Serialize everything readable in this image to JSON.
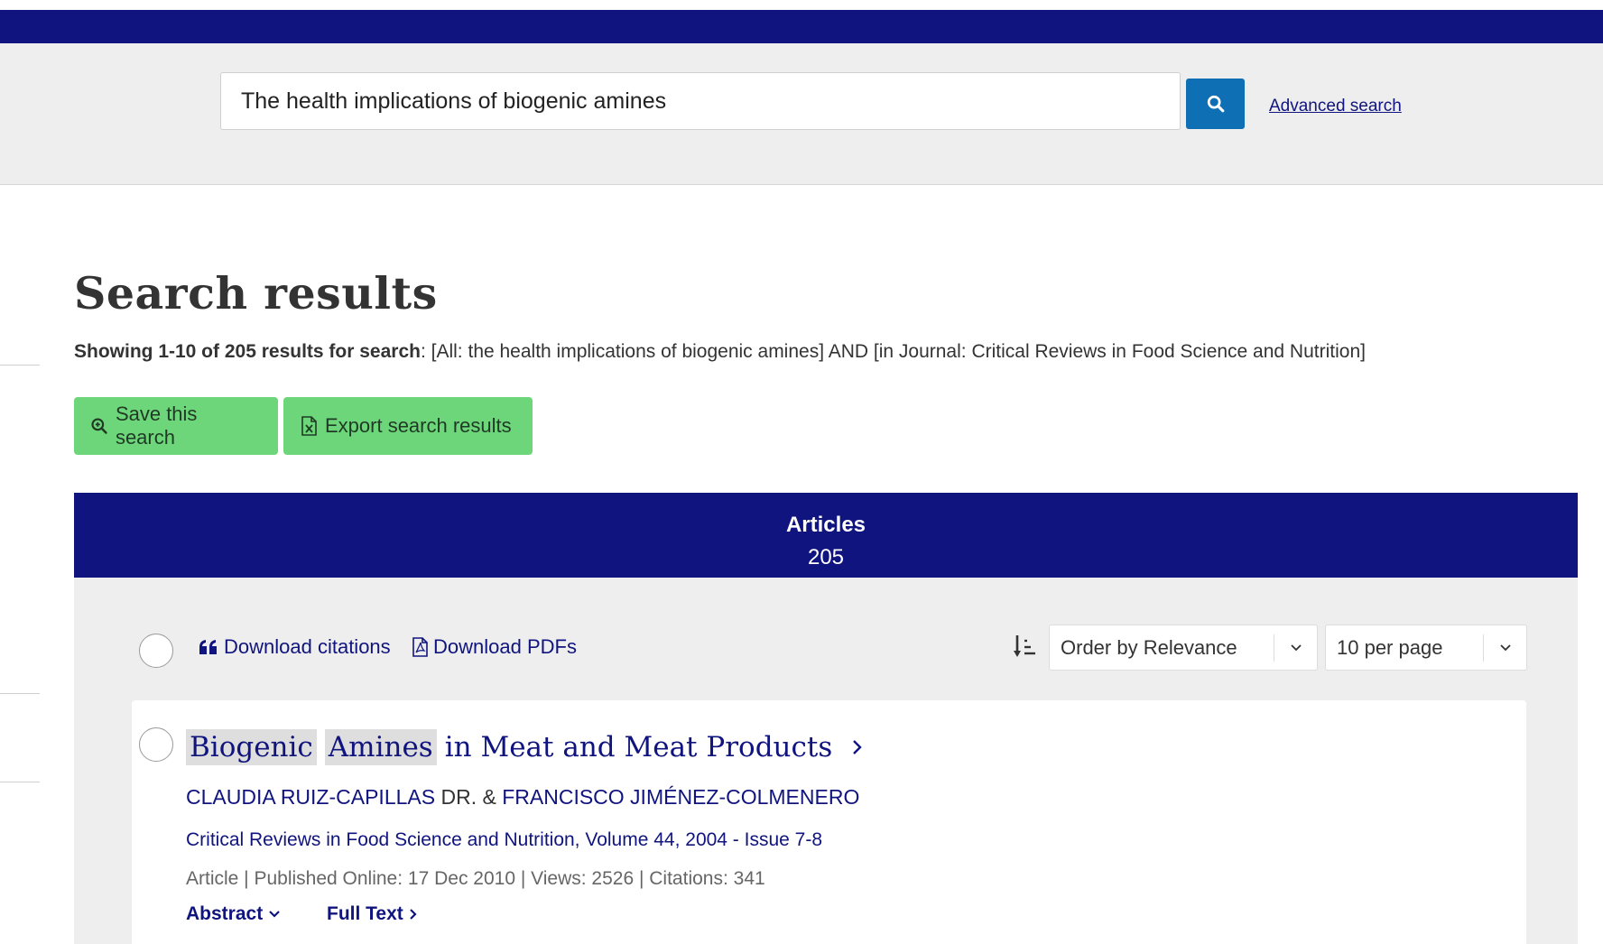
{
  "search": {
    "query": "The health implications of biogenic amines",
    "button_icon": "search-icon",
    "advanced_link": "Advanced search"
  },
  "page": {
    "title": "Search results",
    "summary_bold": "Showing 1-10 of 205 results for search",
    "summary_rest": ": [All: the health implications of biogenic amines] AND [in Journal: Critical Reviews in Food Science and Nutrition]"
  },
  "actions": {
    "save_search": "Save this search",
    "export_results": "Export search results"
  },
  "tabs": {
    "articles_label": "Articles",
    "articles_count": "205"
  },
  "toolbar": {
    "download_citations": "Download citations",
    "download_pdfs": "Download PDFs",
    "sort_selected": "Order by Relevance",
    "per_page_selected": "10 per page"
  },
  "results": [
    {
      "title_highlight_1": "Biogenic",
      "title_highlight_2": "Amines",
      "title_rest": "in Meat and Meat Products",
      "author_1": "CLAUDIA RUIZ-CAPILLAS",
      "author_separator": "DR. &",
      "author_2": "FRANCISCO JIMÉNEZ-COLMENERO",
      "journal": "Critical Reviews in Food Science and Nutrition, Volume 44, 2004 - Issue 7-8",
      "meta": "Article | Published Online: 17 Dec 2010 | Views: 2526 | Citations: 341",
      "abstract_label": "Abstract",
      "fulltext_label": "Full Text"
    }
  ],
  "colors": {
    "brand_navy": "#10147e",
    "action_green": "#6ed67a",
    "search_blue": "#0f6fb4",
    "panel_gray": "#eeeeee"
  }
}
